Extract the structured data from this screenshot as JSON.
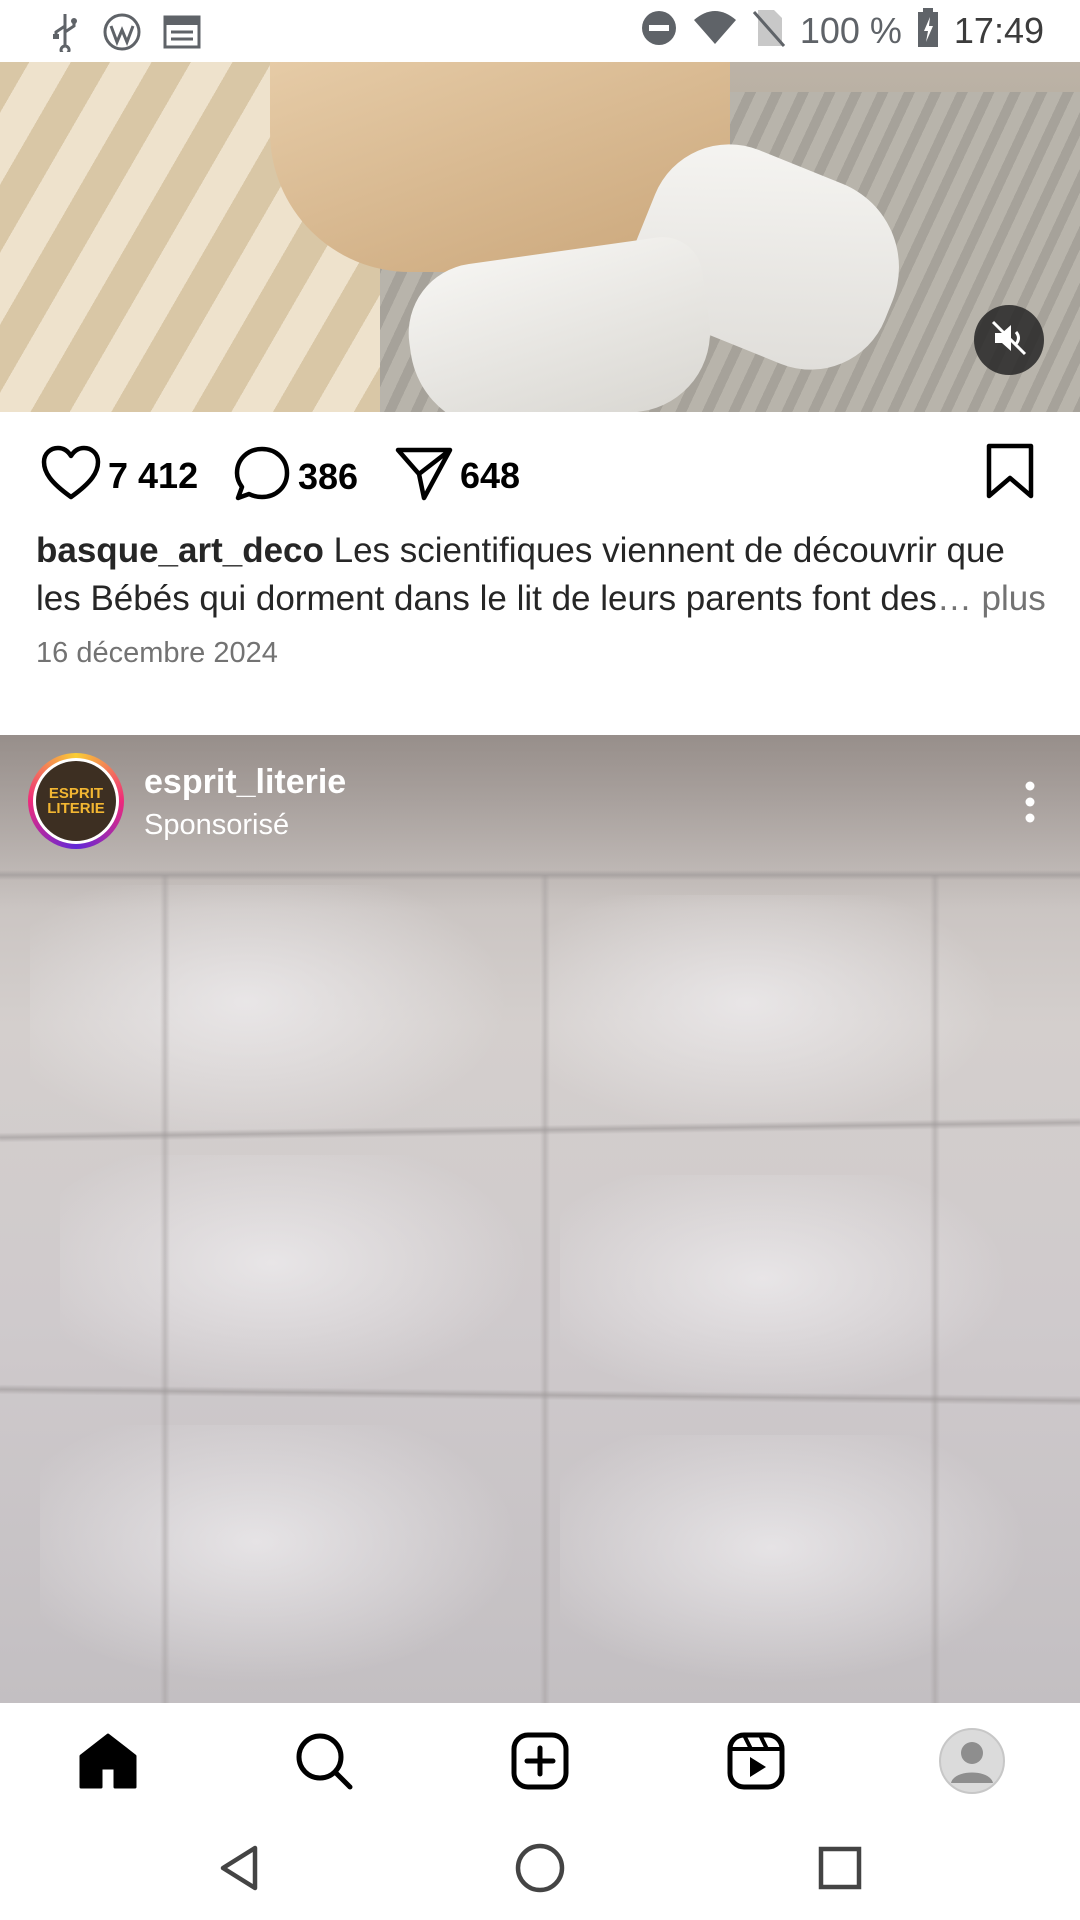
{
  "status_bar": {
    "battery": "100 %",
    "time": "17:49"
  },
  "post1": {
    "likes": "7 412",
    "comments": "386",
    "shares": "648",
    "caption_user": "basque_art_deco",
    "caption_text": " Les scientifiques viennent de découvrir que les Bébés qui dorment dans le lit de leurs parents font des",
    "caption_ellipsis": "…",
    "caption_more": " plus",
    "date": "16 décembre 2024"
  },
  "post2": {
    "username": "esprit_literie",
    "subtitle": "Sponsorisé",
    "logo_line1": "ESPRIT",
    "logo_line2": "LITERIE"
  },
  "icons": {
    "status_left": [
      "usb-icon",
      "wordpress-icon",
      "calendar-icon"
    ],
    "status_right": [
      "dnd-icon",
      "wifi-icon",
      "no-sim-icon",
      "battery-icon"
    ],
    "post_actions": [
      "heart-icon",
      "comment-icon",
      "share-icon",
      "bookmark-icon"
    ],
    "bottom_nav": [
      "home-icon",
      "search-icon",
      "create-icon",
      "reels-icon",
      "profile-icon"
    ],
    "system_nav": [
      "back-icon",
      "home-circle-icon",
      "recents-icon"
    ]
  },
  "colors": {
    "text": "#262626",
    "secondary_text": "#737373",
    "sponsored_ring": "#ee2a7b",
    "logo_bg": "#3d2f22",
    "logo_text": "#f2b632"
  }
}
